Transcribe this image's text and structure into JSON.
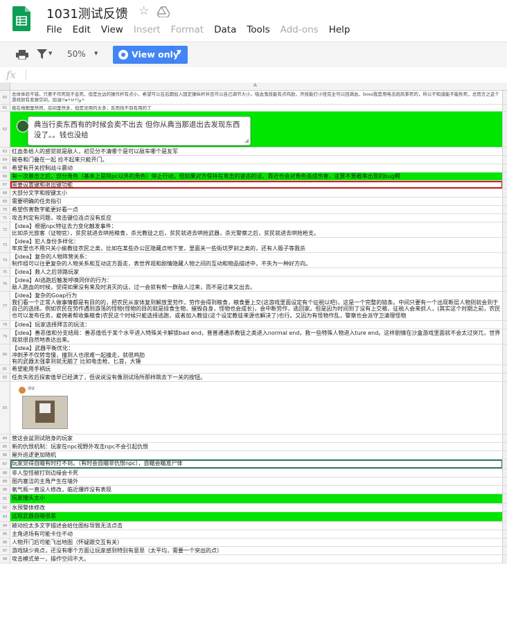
{
  "app": {
    "title": "1031测试反馈",
    "menu": [
      "File",
      "Edit",
      "View",
      "Insert",
      "Format",
      "Data",
      "Tools",
      "Add-ons",
      "Help"
    ],
    "menu_disabled": [
      "Insert",
      "Format",
      "Add-ons"
    ]
  },
  "toolbar": {
    "zoom": "50%",
    "view_only_label": "View only"
  },
  "formula_bar": {
    "fx": "fx"
  },
  "sheet": {
    "column_label": "A"
  },
  "rows": [
    {
      "n": "60",
      "text": "总体体验不错，只要不作死就不会死，但是左边的操作杆有点小，希望可以在后期加入固定操纵杆并且可以自己调节大小，吸血鬼技能有点鸡肋，开技能打小怪完全可以回满血，boss我是用电击炮风筝死的，所以不知道能不能秒死，总而言之这个游戏很有发展空间，加油!(๑•̀ㅂ•́)و✧",
      "style": "small",
      "h": 20
    },
    {
      "n": "61",
      "text": "我在地图里然然，房间里然多，但是没用的太多，反而找不到有用的了",
      "style": "small",
      "h": 10
    },
    {
      "n": "62",
      "text": "",
      "style": "green-comment",
      "h": 52
    },
    {
      "n": "63",
      "text": "红血条给人的感觉就是敌人，初见分不清哪个是可以敌车哪个是友军",
      "h": 12
    },
    {
      "n": "64",
      "text": "碗卷和门叠在一起 捡不起来只能开门。",
      "h": 12
    },
    {
      "n": "65",
      "text": "希望有开关控制战斗震动",
      "h": 12
    },
    {
      "n": "66",
      "text": "有一次暴击之后，部分角色（基本上是除pc以外的角色）停止行动，但如果对方保持在攻击的姿态的话，靠近也会对角色造成伤害，这算不算概率出现的bug啊",
      "style": "green",
      "h": 12
    },
    {
      "n": "67",
      "text": "需要设置键和退出键功能",
      "style": "red",
      "h": 12
    },
    {
      "n": "68",
      "text": "大部分文字和按键太小",
      "h": 12
    },
    {
      "n": "69",
      "text": "需要明确的任务指引",
      "h": 12
    },
    {
      "n": "70",
      "text": "希望伤害数字能更好看一点",
      "h": 12
    },
    {
      "n": "71",
      "text": "攻击判定有问题，攻击键位连点没有反应",
      "h": 12
    },
    {
      "n": "72",
      "text": "【idea】根据npc特征去力变化触发事件：\n比如杀光旅客（证物官），贫民就进去哄抢粮食，杀光教徒之后，贫民就进去哄抢武器，杀光警察之后，贫民就进去哄抢枪支。",
      "h": 22
    },
    {
      "n": "73",
      "text": "【idea】犯人身份多样化：\n牢房里也不用只关小偷教徒农民之类，比如在某些办公区隐藏点地下室，里面关一些街坊罗刹之类的，还有人贩子等我杀",
      "h": 22
    },
    {
      "n": "74",
      "text": "【idea】复杂的人物阵营关系：\n制作组可以往更复杂的人物关系和互动这方面走，表世界观和剧情隐藏人物之间的互动和物品描述中，不失为一种好方向。",
      "h": 22
    },
    {
      "n": "75",
      "text": "【idea】救人之后领路玩家",
      "h": 12
    },
    {
      "n": "76",
      "text": "【idea】AI逃跑后触发呼唤同伴的行为：\n敌人跑血的时候，觉得如果没有来及时消灭的话，过一会就有帮一群敌人过来，而不是过来又出去。",
      "h": 22
    },
    {
      "n": "77",
      "text": "【idea】复杂的Goap行为\n我们看一个正常人做事情都是有目的的，把农民从家体复到解放里劳作，劳作会得到粮食，粮食要上交(这游戏里面设定有个征税以吧)，这是一个完整的链条。中间只要有一个出现断层人物则就会到于自己的选择。例如农民在劳作遇到游荡的怪物(怪物的目的就是掠食生物，摧毁自身，怪物也会成长)，会中断劳作，逃回家。但是因为时间到了没有上交粮，征税人会来抓人，(其实这个时期之前，农民也可以发布任务，雇佣者帮收集粮食)农民这个时候只能选择逃跑，或者加入教徒(这个设定教徒来源也解决了)也行。又因为有怪物作乱，警察也会派守卫清理怪物",
      "h": 42
    },
    {
      "n": "78",
      "text": "【idea】玩家选择拜言的玩法：",
      "h": 12
    },
    {
      "n": "79",
      "text": "【idea】善恶值和分支结局：善恶值低于某个水平进入特殊关卡解锁bad end，普普通通杀教徒之类进入normal end，救一些特殊人物进入ture end。这样剧情在沙盒游戏里面就不会太过突兀，世界观就很自然地表达出来。",
      "h": 22
    },
    {
      "n": "80",
      "text": "【idea】武器平衡优化：\n冲刺矛不仅转弯慢，撞到人也很难一起撞走，就很鸡肋\n有的武器太强拿到就无脑了 比如电击枪、匕首，大锤",
      "h": 30
    },
    {
      "n": "81",
      "text": "希望能用手柄玩",
      "h": 12
    },
    {
      "n": "82",
      "text": "任务失败后探索值早已经满了，但说说没有像测试场所那样跳去下一关的按钮。",
      "h": 12
    },
    {
      "n": "83",
      "text": "",
      "style": "thumb",
      "h": 76
    },
    {
      "n": "84",
      "text": "营这会盆测试陪身的玩家",
      "h": 12
    },
    {
      "n": "85",
      "text": "新的仇恨机制：玩家在npc视野外攻击npc不会引起仇恨",
      "h": 12
    },
    {
      "n": "86",
      "text": "屋外巡逻更加随机",
      "h": 12
    },
    {
      "n": "87",
      "text": "玩家觉得自瞄有时打不到。（有时会自瞄非仇恨npc），自瞄会瞄准尸体",
      "style": "teal",
      "h": 14
    },
    {
      "n": "88",
      "text": "非人型怪被打到边缘会卡死",
      "h": 12
    },
    {
      "n": "89",
      "text": "图内塞洁的主角产生在墙外",
      "h": 12
    },
    {
      "n": "90",
      "text": "氧气瓶一直没人修改，临近爆炸没有表现",
      "h": 12
    },
    {
      "n": "91",
      "text": "玩家撞头太小",
      "style": "green",
      "h": 14
    },
    {
      "n": "92",
      "text": "水预警体修改",
      "h": 12
    },
    {
      "n": "93",
      "text": "远程武器自瞄很差",
      "style": "green",
      "h": 14
    },
    {
      "n": "94",
      "text": "被动捡太多文字描述会给住图标导致无法点击",
      "h": 12
    },
    {
      "n": "95",
      "text": "主角进场有可能卡住不动",
      "h": 12
    },
    {
      "n": "96",
      "text": "人物开门后可能飞出地图（怀疑跟交互有关）",
      "h": 12
    },
    {
      "n": "97",
      "text": "游戏缺少亮点，还没有哪个方面让玩家感到特别有意思（太平均，需要一个突出的点）",
      "h": 12
    },
    {
      "n": "98",
      "text": "攻击模式单一，操作空间不大。",
      "h": 12
    }
  ],
  "comment": {
    "text": "典当行卖东西有的时候会卖不出去 但你从典当那退出去发现东西没了。。钱也没给"
  },
  "thumb": {
    "name": "测试"
  },
  "colors": {
    "highlight_green": "#00e600",
    "red_border": "#d01a1a",
    "accent_blue": "#4285f4"
  }
}
